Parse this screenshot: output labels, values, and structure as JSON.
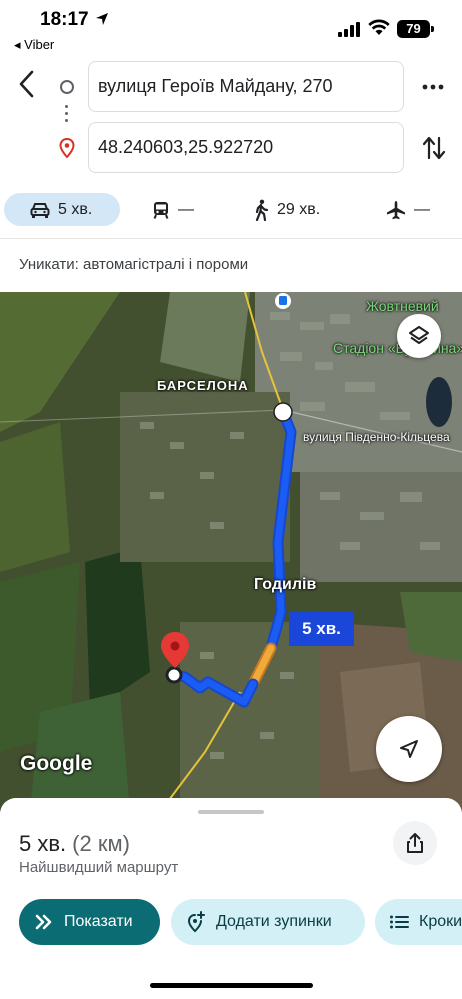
{
  "status_bar": {
    "time": "18:17",
    "back_app": "◂ Viber",
    "battery": "79"
  },
  "route": {
    "from": "вулиця Героїв Майдану, 270",
    "to": "48.240603,25.922720"
  },
  "modes": {
    "car": "5 хв.",
    "transit": "—",
    "walk": "29 хв.",
    "flight": "—"
  },
  "avoid_text": "Уникати: автомагістралі і пороми",
  "map": {
    "labels": {
      "barcelona": "БАРСЕЛОНА",
      "street": "вулиця Південно-Кільцева",
      "zhovtnevyi": "Жовтневий",
      "stadion": "Стадіон «Буковина»",
      "godyliv": "Годилів",
      "google": "Google"
    },
    "route_time": "5 хв.",
    "route_color": "#1a5cf5",
    "traffic_color": "#f2a93b"
  },
  "summary": {
    "duration": "5 хв.",
    "distance": "(2 км)",
    "description": "Найшвидший маршрут"
  },
  "actions": {
    "show": "Показати",
    "add_stops": "Додати зупинки",
    "steps": "Кроки"
  }
}
